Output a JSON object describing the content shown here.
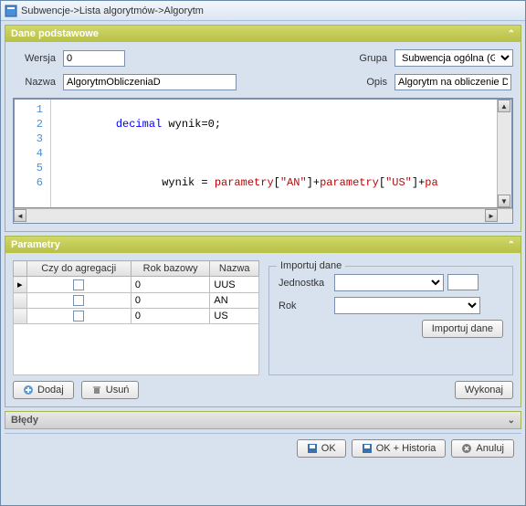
{
  "titlebar": {
    "breadcrumb": "Subwencje->Lista algorytmów->Algorytm"
  },
  "basic": {
    "header": "Dane podstawowe",
    "wersja_label": "Wersja",
    "wersja_value": "0",
    "nazwa_label": "Nazwa",
    "nazwa_value": "AlgorytmObliczeniaD",
    "grupa_label": "Grupa",
    "grupa_value": "Subwencja ogólna (Gmi",
    "opis_label": "Opis",
    "opis_value": "Algorytm na obliczenie D dane"
  },
  "code": {
    "lines": [
      "1",
      "2",
      "3",
      "4",
      "5",
      "6"
    ]
  },
  "params": {
    "header": "Parametry",
    "columns": {
      "agr": "Czy do agregacji",
      "rok": "Rok bazowy",
      "nazwa": "Nazwa"
    },
    "rows": [
      {
        "agr": false,
        "rok": "0",
        "nazwa": "UUS"
      },
      {
        "agr": false,
        "rok": "0",
        "nazwa": "AN"
      },
      {
        "agr": false,
        "rok": "0",
        "nazwa": "US"
      }
    ],
    "import": {
      "legend": "Importuj dane",
      "jednostka_label": "Jednostka",
      "rok_label": "Rok",
      "btn": "Importuj dane"
    },
    "dodaj": "Dodaj",
    "usun": "Usuń",
    "wykonaj": "Wykonaj"
  },
  "bledy": {
    "header": "Błędy"
  },
  "footer": {
    "ok": "OK",
    "ok_hist": "OK + Historia",
    "anuluj": "Anuluj"
  }
}
